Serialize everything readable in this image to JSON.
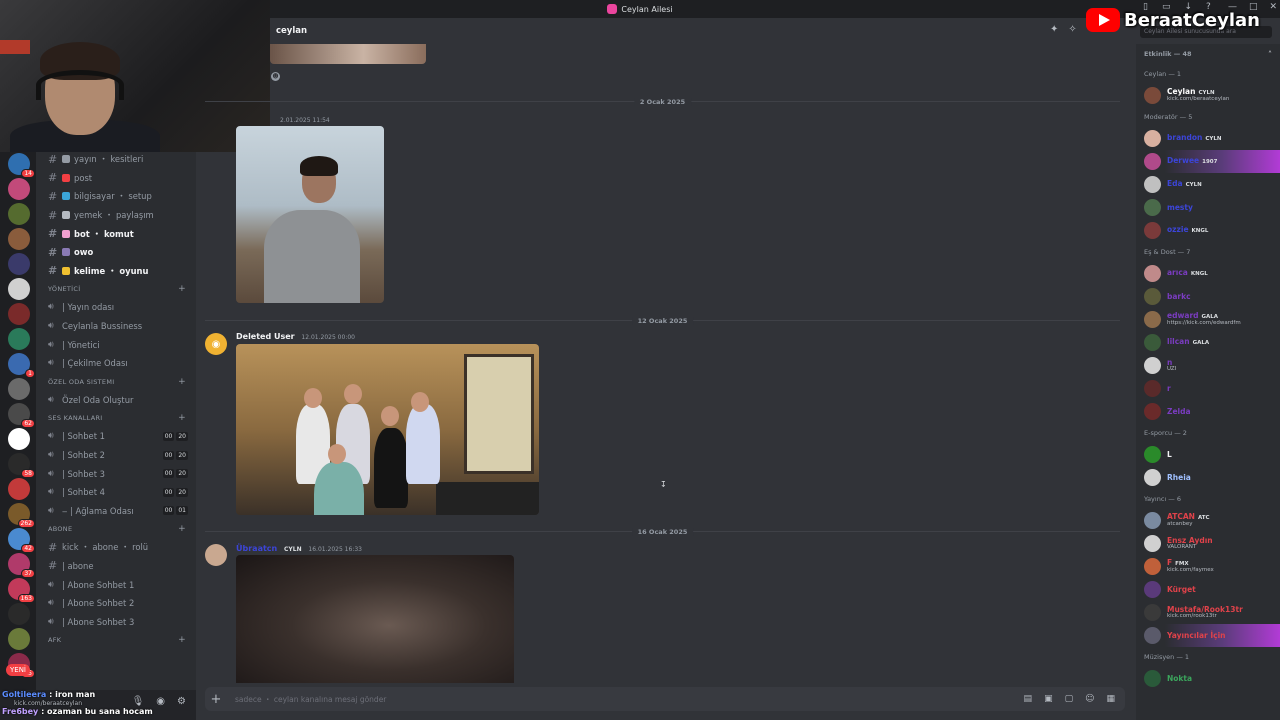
{
  "window": {
    "title": "Ceylan Ailesi",
    "controls": [
      "—",
      "□",
      "✕"
    ]
  },
  "youtube_overlay": {
    "channel": "BeraatCeylan"
  },
  "chat_header": {
    "channel_name": "ceylan",
    "search_placeholder": "Ceylan Ailesi sunucusunda ara"
  },
  "guild_badges": [
    "14",
    "",
    "",
    "",
    "",
    "",
    "",
    "",
    "1",
    "",
    "62",
    "",
    "58",
    "",
    "262",
    "42",
    "37",
    "163",
    "",
    "",
    "15"
  ],
  "guild_colors": [
    "#2f6fb0",
    "#c24a7a",
    "#556b2f",
    "#8a5c3c",
    "#3a3a6a",
    "#d0d0d0",
    "#7a2a2a",
    "#2a7a5a",
    "#3a6ab0",
    "#6a6a6a",
    "#4a4a4a",
    "#ffffff",
    "#2a2a2a",
    "#c23a3a",
    "#7a5a2a",
    "#4a8ad0",
    "#b03a6a",
    "#c23a5a",
    "#2a2a2a",
    "#6a7a3a",
    "#8a2a4a"
  ],
  "new_button": "YENİ",
  "channels": {
    "text": [
      {
        "label": "yayın ・ kesitleri",
        "color": "#949ba4",
        "bold": false
      },
      {
        "label": "post",
        "color": "#f23f43",
        "bold": false
      },
      {
        "label": "bilgisayar ・ setup",
        "color": "#3ba5d8",
        "bold": false
      },
      {
        "label": "yemek ・ paylaşım",
        "color": "#b5bac1",
        "bold": false
      },
      {
        "label": "bot ・ komut",
        "color": "#f2a0d0",
        "bold": true
      },
      {
        "label": "owo",
        "color": "#8a7ab5",
        "bold": true
      },
      {
        "label": "kelime ・ oyunu",
        "color": "#f0c030",
        "bold": true
      }
    ],
    "yonetici_category": "YÖNETİCİ",
    "yonetici": [
      "| Yayın odası",
      "Ceylanla Bussiness",
      "| Yönetici",
      "| Çekilme Odası"
    ],
    "ozel_category": "Özel Oda Sistemi",
    "ozel": [
      "Özel Oda Oluştur"
    ],
    "ses_category": "SES KANALLARI",
    "ses": [
      {
        "label": "| Sohbet 1",
        "a": "00",
        "b": "20"
      },
      {
        "label": "| Sohbet 2",
        "a": "00",
        "b": "20"
      },
      {
        "label": "| Sohbet 3",
        "a": "00",
        "b": "20"
      },
      {
        "label": "| Sohbet 4",
        "a": "00",
        "b": "20"
      },
      {
        "label": "‒ | Ağlama Odası",
        "a": "00",
        "b": "01"
      }
    ],
    "abone_category": "ABONE",
    "abone": [
      "kick ・ abone ・ rolü",
      "| abone",
      "| Abone Sohbet 1",
      "| Abone Sohbet 2",
      "| Abone Sohbet 3"
    ],
    "afk_category": "AFK"
  },
  "userbar": {
    "line1_user": "Goltileera",
    "line1_text": ": iron man",
    "line2_sub": "kick.com/beraatceylan",
    "line3_user": "Fre6bey",
    "line3_text": ": ozaman bu sana hocam"
  },
  "messages": {
    "date1": "2 Ocak 2025",
    "msg1_time": "2.01.2025 11:54",
    "date2": "12 Ocak 2025",
    "msg2_author": "Deleted User",
    "msg2_time": "12.01.2025 00:00",
    "date3": "16 Ocak 2025",
    "msg3_author": "Übraatcn",
    "msg3_tag": "CYLN",
    "msg3_time": "16.01.2025 16:33"
  },
  "composer": {
    "placeholder": "sadece ・ ceylan kanalına mesaj gönder"
  },
  "members": {
    "header": "Etkinlik — 48",
    "groups": [
      {
        "title": "Ceylan — 1",
        "members": [
          {
            "name": "Ceylan",
            "tag": "CYLN",
            "sub": "kick.com/beraatceylan",
            "color": "#ffffff",
            "av": "#7a4a3a"
          }
        ]
      },
      {
        "title": "Moderatör — 5",
        "members": [
          {
            "name": "brandon",
            "tag": "CYLN",
            "sub": "",
            "color": "#3c45d8",
            "av": "#d8b0a0"
          },
          {
            "name": "Derwee",
            "tag": "1907",
            "sub": "",
            "color": "#3c45d8",
            "av": "#b04a8a",
            "hl": true
          },
          {
            "name": "Eda",
            "tag": "CYLN",
            "sub": "",
            "color": "#3c45d8",
            "av": "#c0c0c0"
          },
          {
            "name": "mesty",
            "tag": "",
            "sub": "",
            "color": "#3c45d8",
            "av": "#4a6a4a"
          },
          {
            "name": "ozzie",
            "tag": "KNGL",
            "sub": "",
            "color": "#3c45d8",
            "av": "#7a3a3a"
          }
        ]
      },
      {
        "title": "Eş & Dost — 7",
        "members": [
          {
            "name": "arıca",
            "tag": "KNGL",
            "sub": "",
            "color": "#7a3cc0",
            "av": "#c08a8a"
          },
          {
            "name": "barkc",
            "tag": "",
            "sub": "",
            "color": "#7a3cc0",
            "av": "#5a5a3a"
          },
          {
            "name": "edward",
            "tag": "GALA",
            "sub": "https://kick.com/edwardfm",
            "color": "#7a3cc0",
            "av": "#8a6a4a"
          },
          {
            "name": "lilcan",
            "tag": "GALA",
            "sub": "",
            "color": "#7a3cc0",
            "av": "#3a5a3a"
          },
          {
            "name": "n",
            "tag": "",
            "sub": "UZI",
            "color": "#7a3cc0",
            "av": "#d0d0d0"
          },
          {
            "name": "r",
            "tag": "",
            "sub": "",
            "color": "#7a3cc0",
            "av": "#5a2a2a"
          },
          {
            "name": "Zelda",
            "tag": "",
            "sub": "",
            "color": "#7a3cc0",
            "av": "#6a2a2a"
          }
        ]
      },
      {
        "title": "E-sporcu — 2",
        "members": [
          {
            "name": "L",
            "tag": "",
            "sub": "",
            "color": "#f2f3f5",
            "av": "#2a8a2a"
          },
          {
            "name": "Rheia",
            "tag": "",
            "sub": "",
            "color": "#a0c0ff",
            "av": "#d0d0d0"
          }
        ]
      },
      {
        "title": "Yayıncı — 6",
        "members": [
          {
            "name": "ATCAN",
            "tag": "ATC",
            "sub": "atcanbey",
            "color": "#e0424a",
            "av": "#7a8aa0"
          },
          {
            "name": "Ensz Aydın",
            "tag": "",
            "sub": "VALORANT",
            "color": "#e0424a",
            "av": "#d0d0d0"
          },
          {
            "name": "F",
            "tag": "FMX",
            "sub": "kick.com/faymex",
            "color": "#e0424a",
            "av": "#c0603a"
          },
          {
            "name": "Kürget",
            "tag": "",
            "sub": "",
            "color": "#e0424a",
            "av": "#5a3a7a"
          },
          {
            "name": "Mustafa/Rook13tr",
            "tag": "",
            "sub": "kick.com/rook13tr",
            "color": "#e0424a",
            "av": "#3a3a3a"
          },
          {
            "name": "Yayıncılar İçin",
            "tag": "",
            "sub": "",
            "color": "#e0424a",
            "av": "#5a5a6a",
            "hl": true
          }
        ]
      },
      {
        "title": "Müzisyen — 1",
        "members": [
          {
            "name": "Nokta",
            "tag": "",
            "sub": "",
            "color": "#3ba55c",
            "av": "#2a5a3a"
          }
        ]
      }
    ]
  }
}
